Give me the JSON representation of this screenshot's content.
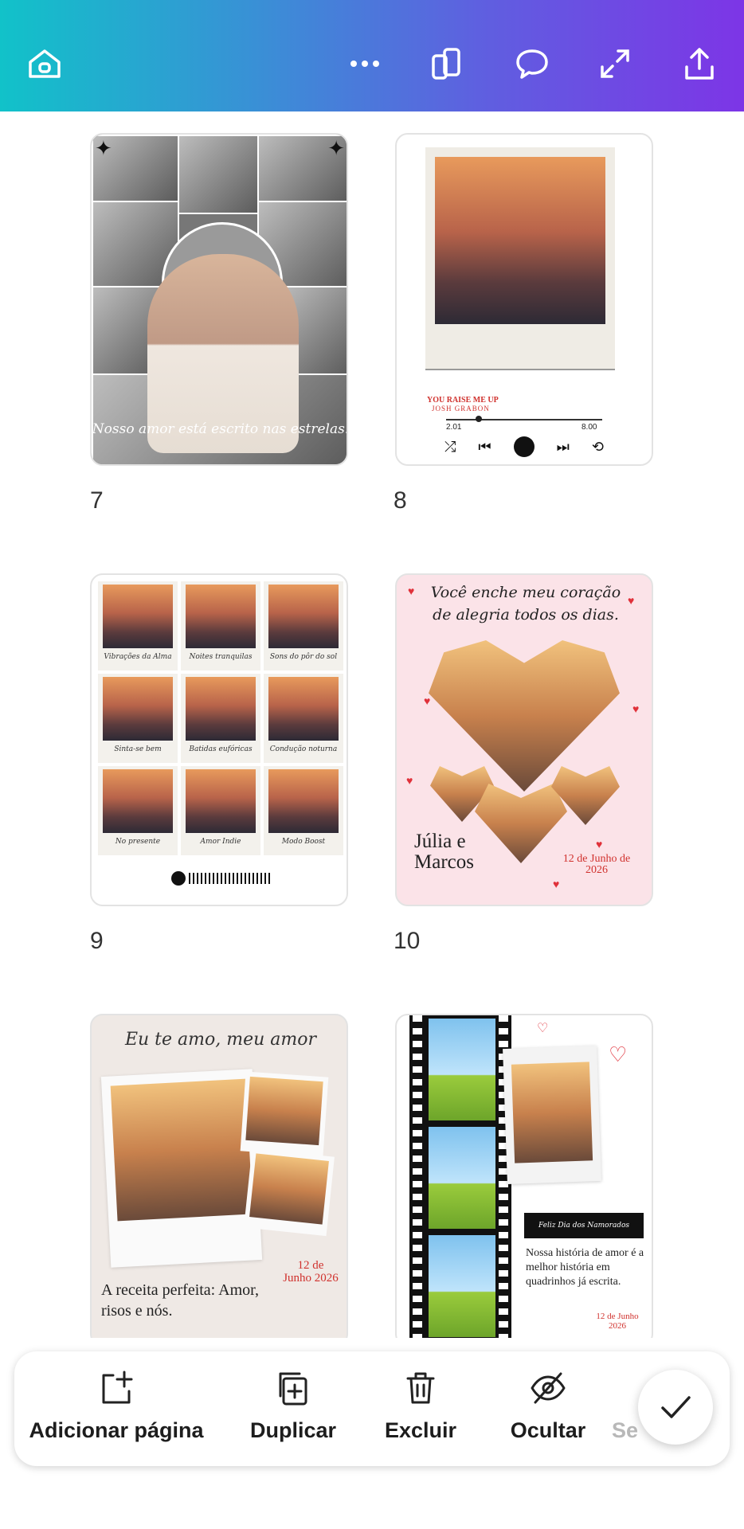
{
  "toolbar": {
    "icons": [
      "home-icon",
      "more-icon",
      "pages-icon",
      "comment-icon",
      "expand-icon",
      "share-icon"
    ]
  },
  "pages": [
    {
      "number": "7",
      "caption": "Nosso amor está escrito nas estrelas."
    },
    {
      "number": "8",
      "song": "YOU RAISE ME UP",
      "artist": "JOSH GRABON",
      "time_start": "2.01",
      "time_end": "8.00"
    },
    {
      "number": "9",
      "labels": [
        "Vibrações da Alma",
        "Noites tranquilas",
        "Sons do pôr do sol",
        "Sinta-se bem",
        "Batidas eufóricas",
        "Condução noturna",
        "No presente",
        "Amor Indie",
        "Modo Boost"
      ]
    },
    {
      "number": "10",
      "title": "Você enche meu coração de alegria todos os dias.",
      "names": "Júlia e Marcos",
      "date": "12 de Junho de 2026"
    },
    {
      "title": "Eu te amo, meu amor",
      "quote": "A receita perfeita: Amor, risos e nós.",
      "date": "12 de Junho 2026"
    },
    {
      "banner": "Feliz Dia dos Namorados",
      "text": "Nossa história de amor é a melhor história em quadrinhos já escrita.",
      "date": "12 de Junho 2026"
    }
  ],
  "actions": {
    "add_page": "Adicionar página",
    "duplicate": "Duplicar",
    "delete": "Excluir",
    "hide": "Ocultar",
    "more": "Se"
  }
}
